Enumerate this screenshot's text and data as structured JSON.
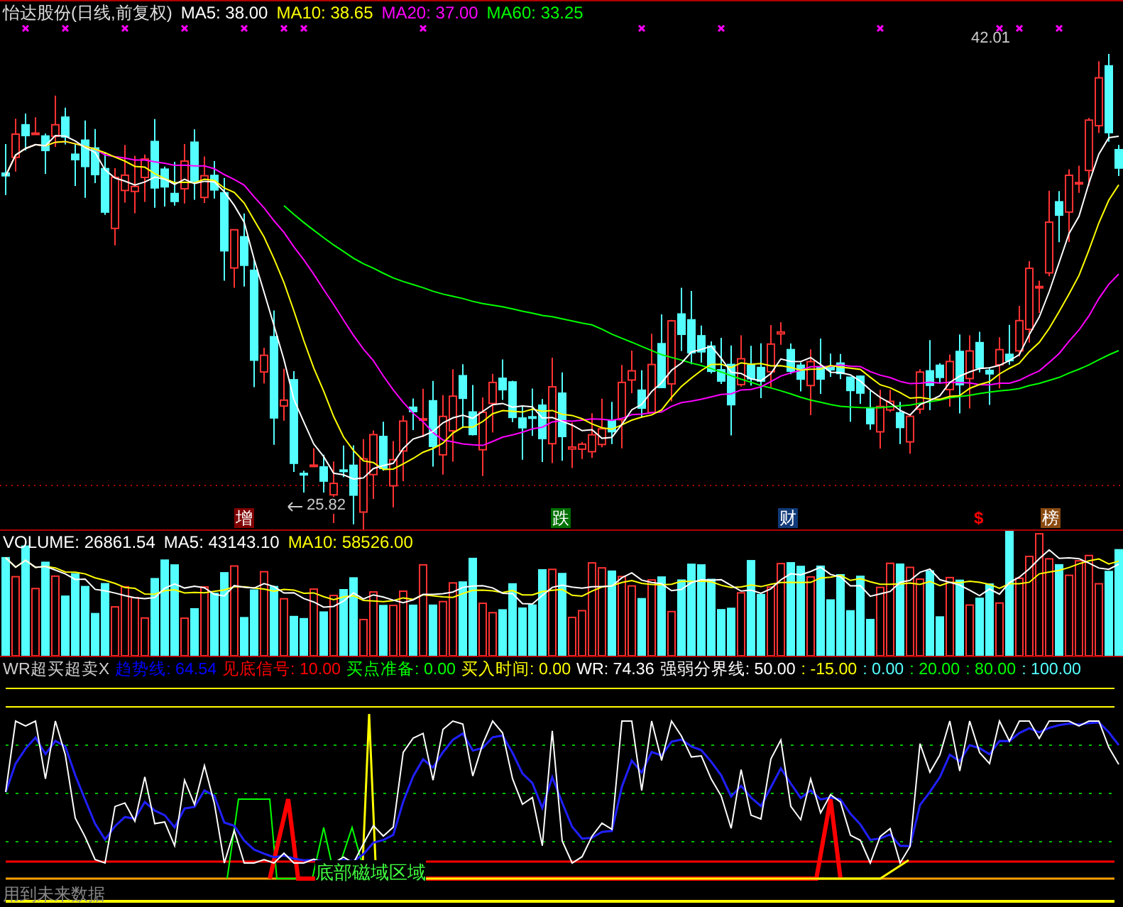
{
  "price_panel": {
    "title": "怡达股份(日线,前复权)",
    "indicators": [
      {
        "label": "MA5: 38.00",
        "color": "#ffffff"
      },
      {
        "label": "MA10: 38.65",
        "color": "#ffff00"
      },
      {
        "label": "MA20: 37.00",
        "color": "#ff00ff"
      },
      {
        "label": "MA60: 33.25",
        "color": "#00ff00"
      }
    ],
    "high_label": "42.01",
    "low_label": "25.82",
    "event_markers": [
      {
        "text": "增",
        "kind": "badge",
        "color": "#800000"
      },
      {
        "text": "跌",
        "kind": "badge",
        "color": "#007000"
      },
      {
        "text": "财",
        "kind": "badge",
        "color": "#103a78"
      },
      {
        "text": "$",
        "kind": "glyph",
        "color": "#ff0000"
      },
      {
        "text": "榜",
        "kind": "badge",
        "color": "#8a4a10"
      }
    ]
  },
  "volume_panel": {
    "indicators": [
      {
        "label": "VOLUME: 26861.54",
        "color": "#ffffff"
      },
      {
        "label": "MA5: 43143.10",
        "color": "#ffffff"
      },
      {
        "label": "MA10: 58526.00",
        "color": "#ffff00"
      }
    ]
  },
  "indicator_panel": {
    "title": "WR超买超卖X",
    "indicators": [
      {
        "label": "趋势线: 64.54",
        "color": "#0000ff"
      },
      {
        "label": "见底信号: 10.00",
        "color": "#ff0000"
      },
      {
        "label": "买点准备: 0.00",
        "color": "#00ff00"
      },
      {
        "label": "买入时间: 0.00",
        "color": "#ffff00"
      },
      {
        "label": "WR: 74.36",
        "color": "#ffffff"
      },
      {
        "label": "强弱分界线: 50.00",
        "color": "#ffffff"
      },
      {
        "label": ": -15.00",
        "color": "#ffff00"
      },
      {
        "label": ": 0.00",
        "color": "#54ffff"
      },
      {
        "label": ": 20.00",
        "color": "#00ff00"
      },
      {
        "label": ": 80.00",
        "color": "#00ff00"
      },
      {
        "label": ": 100.00",
        "color": "#54ffff"
      }
    ],
    "zone_label": "底部磁域区域",
    "warning": "用到未来数据"
  }
}
